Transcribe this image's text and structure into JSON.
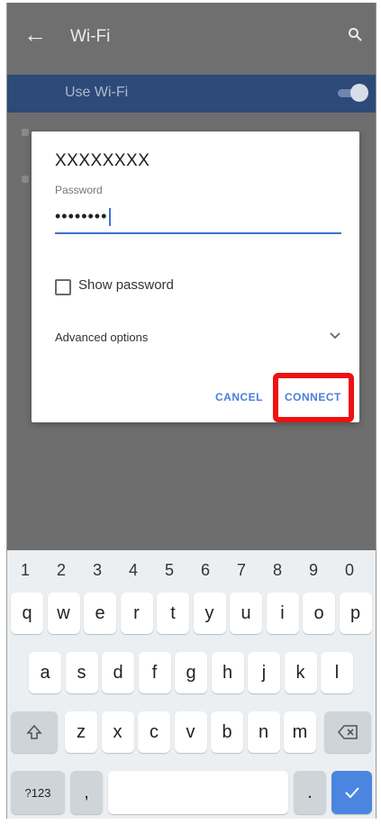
{
  "appbar": {
    "back_icon": "arrow-back-icon",
    "title": "Wi-Fi",
    "search_icon": "search-icon"
  },
  "wifi_toggle": {
    "label": "Use Wi-Fi",
    "state": "on"
  },
  "dialog": {
    "ssid": "XXXXXXXX",
    "password_label": "Password",
    "password_value": "••••••••",
    "show_password_label": "Show password",
    "show_password_checked": false,
    "advanced_options_label": "Advanced options",
    "cancel_label": "CANCEL",
    "connect_label": "CONNECT",
    "highlight_color": "#ee1111"
  },
  "keyboard": {
    "numbers": [
      "1",
      "2",
      "3",
      "4",
      "5",
      "6",
      "7",
      "8",
      "9",
      "0"
    ],
    "row1": [
      "q",
      "w",
      "e",
      "r",
      "t",
      "y",
      "u",
      "i",
      "o",
      "p"
    ],
    "row2": [
      "a",
      "s",
      "d",
      "f",
      "g",
      "h",
      "j",
      "k",
      "l"
    ],
    "row3": [
      "z",
      "x",
      "c",
      "v",
      "b",
      "n",
      "m"
    ],
    "shift_icon": "shift-icon",
    "backspace_icon": "backspace-icon",
    "symbols_label": "?123",
    "comma": ",",
    "period": ".",
    "enter_icon": "checkmark-icon",
    "accent_color": "#4a86e0"
  }
}
